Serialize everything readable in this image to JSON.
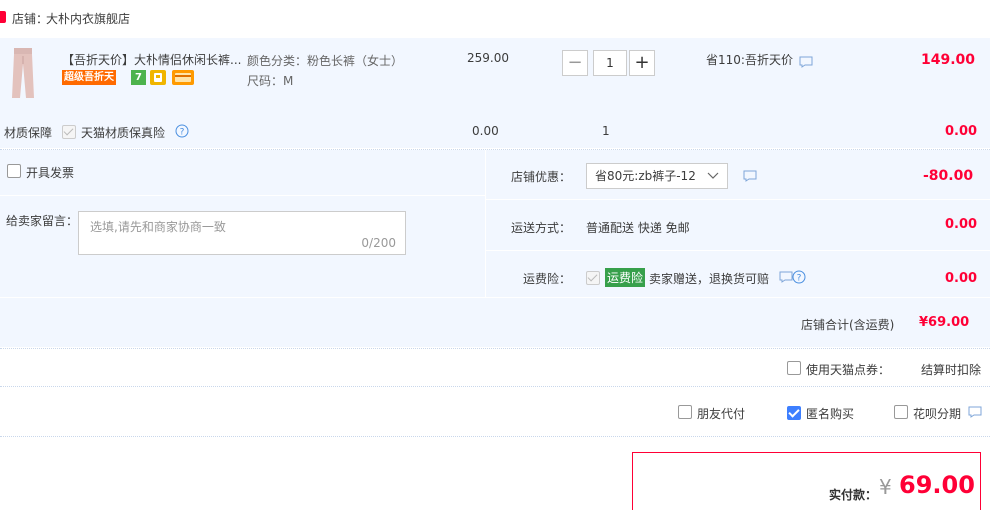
{
  "store": {
    "label": "店铺：",
    "name": "大朴内衣旗舰店"
  },
  "item": {
    "title": "【吾折天价】大朴情侣休闲长裤...",
    "promo_badge": "超级吾折天",
    "badge_seven": "7",
    "sku_color": "颜色分类：粉色长裤（女士）",
    "sku_size": "尺码：M",
    "unit_price": "259.00",
    "quantity": "1",
    "discount": "省110:吾折天价",
    "subtotal": "149.00"
  },
  "warranty": {
    "label": "材质保障",
    "option": "天猫材质保真险",
    "price": "0.00",
    "quantity": "1",
    "subtotal": "0.00"
  },
  "invoice": {
    "label": "开具发票"
  },
  "message": {
    "label": "给卖家留言：",
    "placeholder": "选填,请先和商家协商一致",
    "counter": "0/200"
  },
  "store_discount": {
    "label": "店铺优惠：",
    "selected": "省80元:zb裤子-12",
    "amount": "-80.00"
  },
  "shipping": {
    "label": "运送方式：",
    "value": "普通配送 快递 免邮",
    "amount": "0.00"
  },
  "insurance": {
    "label": "运费险：",
    "badge": "运费险",
    "desc": "卖家赠送，退换货可赔",
    "amount": "0.00"
  },
  "store_total": {
    "label": "店铺合计(含运费)",
    "value": "¥69.00"
  },
  "points": {
    "label": "使用天猫点券：",
    "note": "结算时扣除"
  },
  "options": {
    "friend_pay": "朋友代付",
    "anonymous": "匿名购买",
    "huabei": "花呗分期"
  },
  "payment": {
    "label": "实付款：",
    "currency": "¥",
    "amount": "69.00"
  },
  "colors": {
    "price_red": "#ff0036",
    "panel_bg": "#f2f7ff",
    "checkbox_blue": "#3d7fff",
    "insurance_green": "#37a04b"
  }
}
